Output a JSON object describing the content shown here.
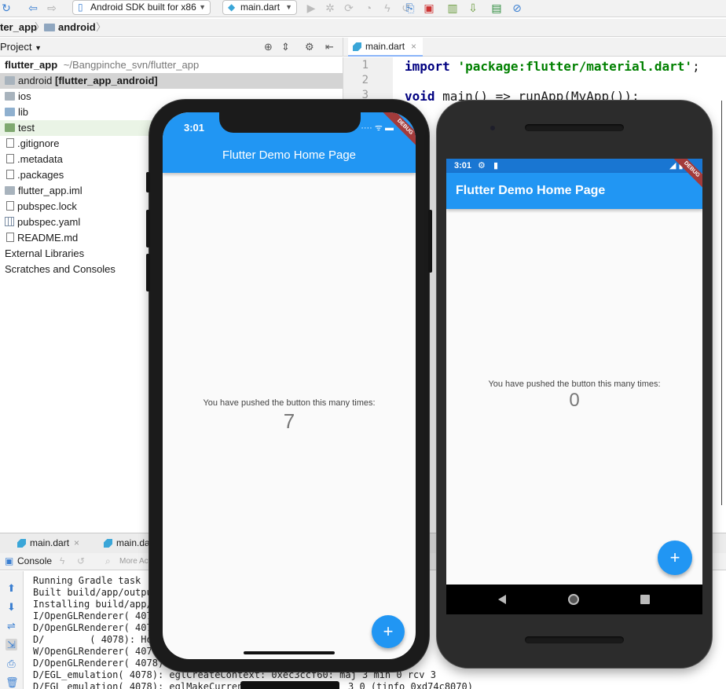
{
  "toolbar": {
    "device_select": "Android SDK built for x86",
    "config_select": "main.dart"
  },
  "breadcrumb": {
    "items": [
      "ter_app",
      "android"
    ]
  },
  "project": {
    "header_label": "Project",
    "tree": [
      {
        "label": "flutter_app",
        "suffix": "~/Bangpinche_svn/flutter_app",
        "icon": "folder-icon"
      },
      {
        "label": "android",
        "suffix": "[flutter_app_android]",
        "icon": "folder-icon"
      },
      {
        "label": "ios",
        "suffix": "",
        "icon": "folder-icon"
      },
      {
        "label": "lib",
        "suffix": "",
        "icon": "folder-icon"
      },
      {
        "label": "test",
        "suffix": "",
        "icon": "folder-icon"
      },
      {
        "label": ".gitignore",
        "suffix": "",
        "icon": "file-icon"
      },
      {
        "label": ".metadata",
        "suffix": "",
        "icon": "file-icon"
      },
      {
        "label": ".packages",
        "suffix": "",
        "icon": "file-icon"
      },
      {
        "label": "flutter_app.iml",
        "suffix": "",
        "icon": "file-icon"
      },
      {
        "label": "pubspec.lock",
        "suffix": "",
        "icon": "file-icon"
      },
      {
        "label": "pubspec.yaml",
        "suffix": "",
        "icon": "grid-file-icon"
      },
      {
        "label": "README.md",
        "suffix": "",
        "icon": "file-icon"
      },
      {
        "label": "External Libraries",
        "suffix": "",
        "icon": "library-icon"
      },
      {
        "label": "Scratches and Consoles",
        "suffix": "",
        "icon": "scratch-icon"
      }
    ]
  },
  "editor": {
    "tab_label": "main.dart",
    "line_numbers": [
      "1",
      "2",
      "3"
    ],
    "line1_kw": "import",
    "line1_str": "'package:flutter/material.dart'",
    "line1_end": ";",
    "line3_kw": "void",
    "line3_rest": " main() => runApp(MyApp());"
  },
  "run": {
    "tabs": [
      "main.dart",
      "main.da"
    ],
    "console_label": "Console",
    "more_actions": "More Acti",
    "lines": [
      "Running Gradle task 'a",
      "Built build/app/output",
      "Installing build/app/o",
      "I/OpenGLRenderer( 4078",
      "D/OpenGLRenderer( 4078",
      "D/        ( 4078): Hos",
      "W/OpenGLRenderer( 4078",
      "D/OpenGLRenderer( 4078):",
      "D/EGL_emulation( 4078): eglCreateContext: 0xec3ccf60: maj 3 min 0 rcv 3",
      "D/EGL_emulation( 4078): eglMakeCurrent"
    ],
    "line10_tail": "3 0 (tinfo 0xd74c8070)"
  },
  "ios_app": {
    "time": "3:01",
    "title": "Flutter Demo Home Page",
    "message": "You have pushed the button this many times:",
    "count": "7",
    "fab": "+",
    "banner": "DEBUG"
  },
  "android_app": {
    "time": "3:01",
    "title": "Flutter Demo Home Page",
    "message": "You have pushed the button this many times:",
    "count": "0",
    "fab": "+",
    "banner": "DEBUG"
  },
  "colors": {
    "flutter_blue": "#2196f3",
    "status_dark_blue": "#1976d2",
    "debug_banner": "#a33b3b"
  }
}
